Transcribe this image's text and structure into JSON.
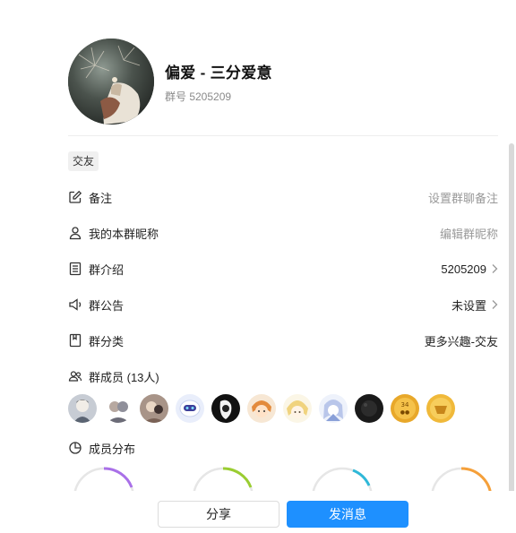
{
  "group": {
    "name": "偏爱 - 三分爱意",
    "id_text": "群号 5205209",
    "tag": "交友"
  },
  "rows": {
    "remark": {
      "label": "备注",
      "value": "设置群聊备注",
      "icon": "edit-icon"
    },
    "nickname": {
      "label": "我的本群昵称",
      "value": "编辑群昵称",
      "icon": "person-icon"
    },
    "intro": {
      "label": "群介绍",
      "value": "5205209",
      "icon": "document-icon"
    },
    "notice": {
      "label": "群公告",
      "value": "未设置",
      "icon": "speaker-icon"
    },
    "category": {
      "label": "群分类",
      "value": "更多兴趣-交友",
      "icon": "bookmark-icon"
    },
    "members": {
      "label": "群成员 (13人)",
      "icon": "members-icon"
    },
    "distribution": {
      "label": "成员分布",
      "icon": "pie-chart-icon"
    }
  },
  "member_avatar_count": 11,
  "distribution_colors": [
    "#a970e8",
    "#9acd32",
    "#2fb8d8",
    "#f5a03a"
  ],
  "footer": {
    "share_label": "分享",
    "send_label": "发消息"
  },
  "colors": {
    "accent": "#1e90ff",
    "muted_text": "#999999"
  }
}
